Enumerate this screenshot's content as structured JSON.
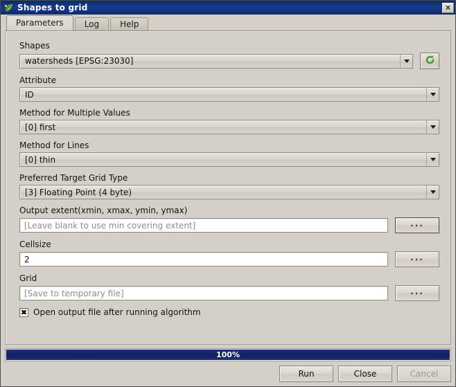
{
  "window": {
    "title": "Shapes to grid",
    "icon": "qgis-leaf-icon",
    "close_label": "✕"
  },
  "tabs": [
    {
      "label": "Parameters",
      "active": true
    },
    {
      "label": "Log",
      "active": false
    },
    {
      "label": "Help",
      "active": false
    }
  ],
  "form": {
    "shapes": {
      "label": "Shapes",
      "value": "watersheds [EPSG:23030]",
      "iterate_icon": "refresh-arrow-icon"
    },
    "attribute": {
      "label": "Attribute",
      "value": "ID"
    },
    "method_multiple": {
      "label": "Method for Multiple Values",
      "value": "[0] first"
    },
    "method_lines": {
      "label": "Method for Lines",
      "value": "[0] thin"
    },
    "grid_type": {
      "label": "Preferred Target Grid Type",
      "value": "[3] Floating Point (4 byte)"
    },
    "output_extent": {
      "label": "Output extent(xmin, xmax, ymin, ymax)",
      "value": "",
      "placeholder": "[Leave blank to use min covering extent]",
      "browse_label": "..."
    },
    "cellsize": {
      "label": "Cellsize",
      "value": "2",
      "browse_label": "..."
    },
    "grid": {
      "label": "Grid",
      "value": "",
      "placeholder": "[Save to temporary file]",
      "browse_label": "..."
    },
    "open_output": {
      "label": "Open output file after running algorithm",
      "checked": true,
      "check_mark": "✖"
    }
  },
  "progress": {
    "percent_label": "100%",
    "value": 100,
    "color": "#1b2f7c"
  },
  "actions": {
    "run": "Run",
    "close": "Close",
    "cancel": "Cancel",
    "cancel_disabled": true
  }
}
